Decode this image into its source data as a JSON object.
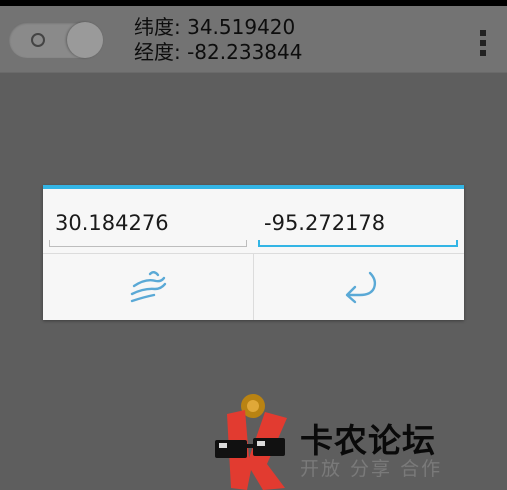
{
  "header": {
    "latitude_text": "纬度: 34.519420",
    "longitude_text": "经度: -82.233844"
  },
  "dialog": {
    "latitude_value": "30.184276",
    "longitude_value": "-95.272178",
    "accent_color": "#33b5e5"
  },
  "icons": {
    "teleport": "teleport-swoosh-icon",
    "back": "return-arrow-icon",
    "menu": "overflow-menu-icon"
  },
  "watermark": {
    "title": "卡农论坛",
    "subtitle": "开放 分享 合作"
  }
}
